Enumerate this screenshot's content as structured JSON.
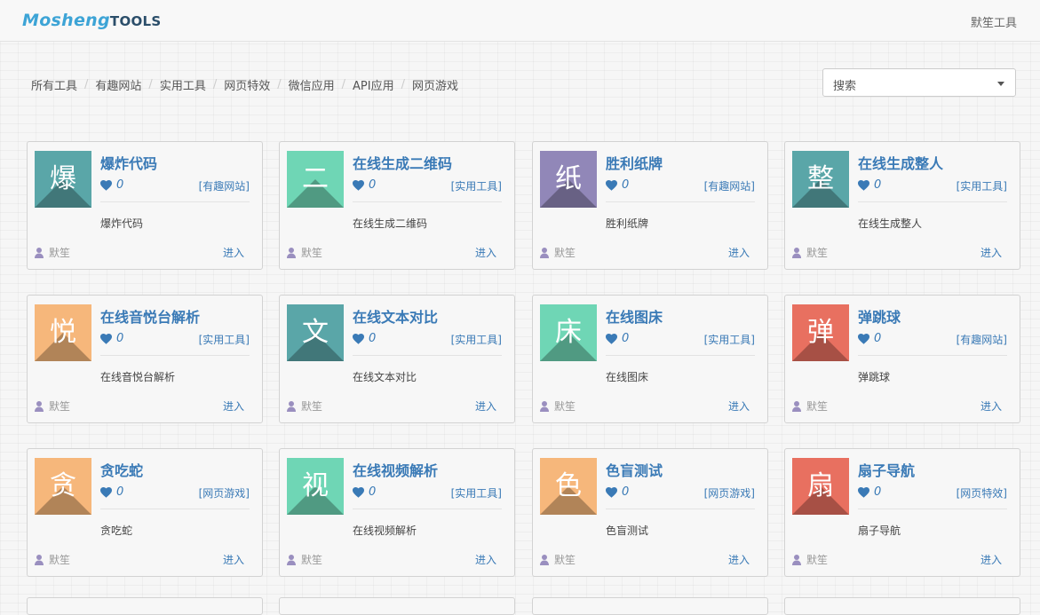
{
  "header": {
    "logo_a": "Mosheng",
    "logo_b": "TOOLS",
    "user": "默笙工具"
  },
  "breadcrumb": [
    "所有工具",
    "有趣网站",
    "实用工具",
    "网页特效",
    "微信应用",
    "API应用",
    "网页游戏"
  ],
  "search": {
    "label": "搜索"
  },
  "colors": {
    "teal": "#5aa6a8",
    "mint": "#6fd6b5",
    "purple": "#9187b8",
    "orange": "#f6b77b",
    "coral": "#e87060",
    "link": "#3a7ab6"
  },
  "tools": [
    {
      "char": "爆",
      "title": "爆炸代码",
      "likes": "0",
      "tag": "[有趣网站]",
      "desc": "爆炸代码",
      "author": "默笙",
      "enter": "进入",
      "color": "#5aa6a8"
    },
    {
      "char": "二",
      "title": "在线生成二维码",
      "likes": "0",
      "tag": "[实用工具]",
      "desc": "在线生成二维码",
      "author": "默笙",
      "enter": "进入",
      "color": "#6fd6b5"
    },
    {
      "char": "纸",
      "title": "胜利纸牌",
      "likes": "0",
      "tag": "[有趣网站]",
      "desc": "胜利纸牌",
      "author": "默笙",
      "enter": "进入",
      "color": "#9187b8"
    },
    {
      "char": "整",
      "title": "在线生成整人",
      "likes": "0",
      "tag": "[实用工具]",
      "desc": "在线生成整人",
      "author": "默笙",
      "enter": "进入",
      "color": "#5aa6a8"
    },
    {
      "char": "悦",
      "title": "在线音悦台解析",
      "likes": "0",
      "tag": "[实用工具]",
      "desc": "在线音悦台解析",
      "author": "默笙",
      "enter": "进入",
      "color": "#f6b77b"
    },
    {
      "char": "文",
      "title": "在线文本对比",
      "likes": "0",
      "tag": "[实用工具]",
      "desc": "在线文本对比",
      "author": "默笙",
      "enter": "进入",
      "color": "#5aa6a8"
    },
    {
      "char": "床",
      "title": "在线图床",
      "likes": "0",
      "tag": "[实用工具]",
      "desc": "在线图床",
      "author": "默笙",
      "enter": "进入",
      "color": "#6fd6b5"
    },
    {
      "char": "弹",
      "title": "弹跳球",
      "likes": "0",
      "tag": "[有趣网站]",
      "desc": "弹跳球",
      "author": "默笙",
      "enter": "进入",
      "color": "#e87060"
    },
    {
      "char": "贪",
      "title": "贪吃蛇",
      "likes": "0",
      "tag": "[网页游戏]",
      "desc": "贪吃蛇",
      "author": "默笙",
      "enter": "进入",
      "color": "#f6b77b"
    },
    {
      "char": "视",
      "title": "在线视频解析",
      "likes": "0",
      "tag": "[实用工具]",
      "desc": "在线视频解析",
      "author": "默笙",
      "enter": "进入",
      "color": "#6fd6b5"
    },
    {
      "char": "色",
      "title": "色盲测试",
      "likes": "0",
      "tag": "[网页游戏]",
      "desc": "色盲测试",
      "author": "默笙",
      "enter": "进入",
      "color": "#f6b77b"
    },
    {
      "char": "扇",
      "title": "扇子导航",
      "likes": "0",
      "tag": "[网页特效]",
      "desc": "扇子导航",
      "author": "默笙",
      "enter": "进入",
      "color": "#e87060"
    }
  ]
}
